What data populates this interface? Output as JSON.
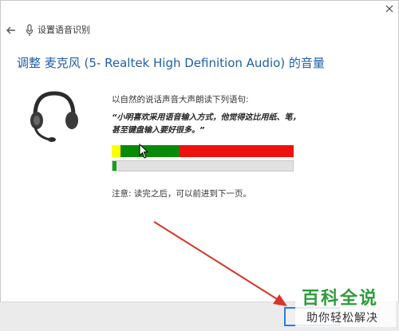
{
  "window": {
    "title": "设置语音识别",
    "back_icon": "back-arrow-icon",
    "close_icon": "close-icon"
  },
  "page": {
    "heading": "调整 麦克风 (5- Realtek High Definition Audio) 的音量",
    "instruction": "以自然的说话声音大声朗读下列语句:",
    "sentence": "“小明喜欢采用语音输入方式，他觉得这比用纸、笔，甚至键盘输入要好很多。”",
    "note": "注意: 读完之后，可以前进到下一页。"
  },
  "meter": {
    "colors": {
      "low": "#ffff00",
      "good": "#0a8a0a",
      "loud": "#ee1111"
    }
  },
  "progress": {
    "fraction": 0.02,
    "color": "#17a117"
  },
  "footer": {
    "next_button_label": ""
  },
  "watermark": {
    "title": "百科全说",
    "subtitle": "助你轻松解决"
  },
  "colors": {
    "heading": "#1f5fa6",
    "accent": "#2b7de0",
    "annotation_arrow": "#d9342b"
  }
}
